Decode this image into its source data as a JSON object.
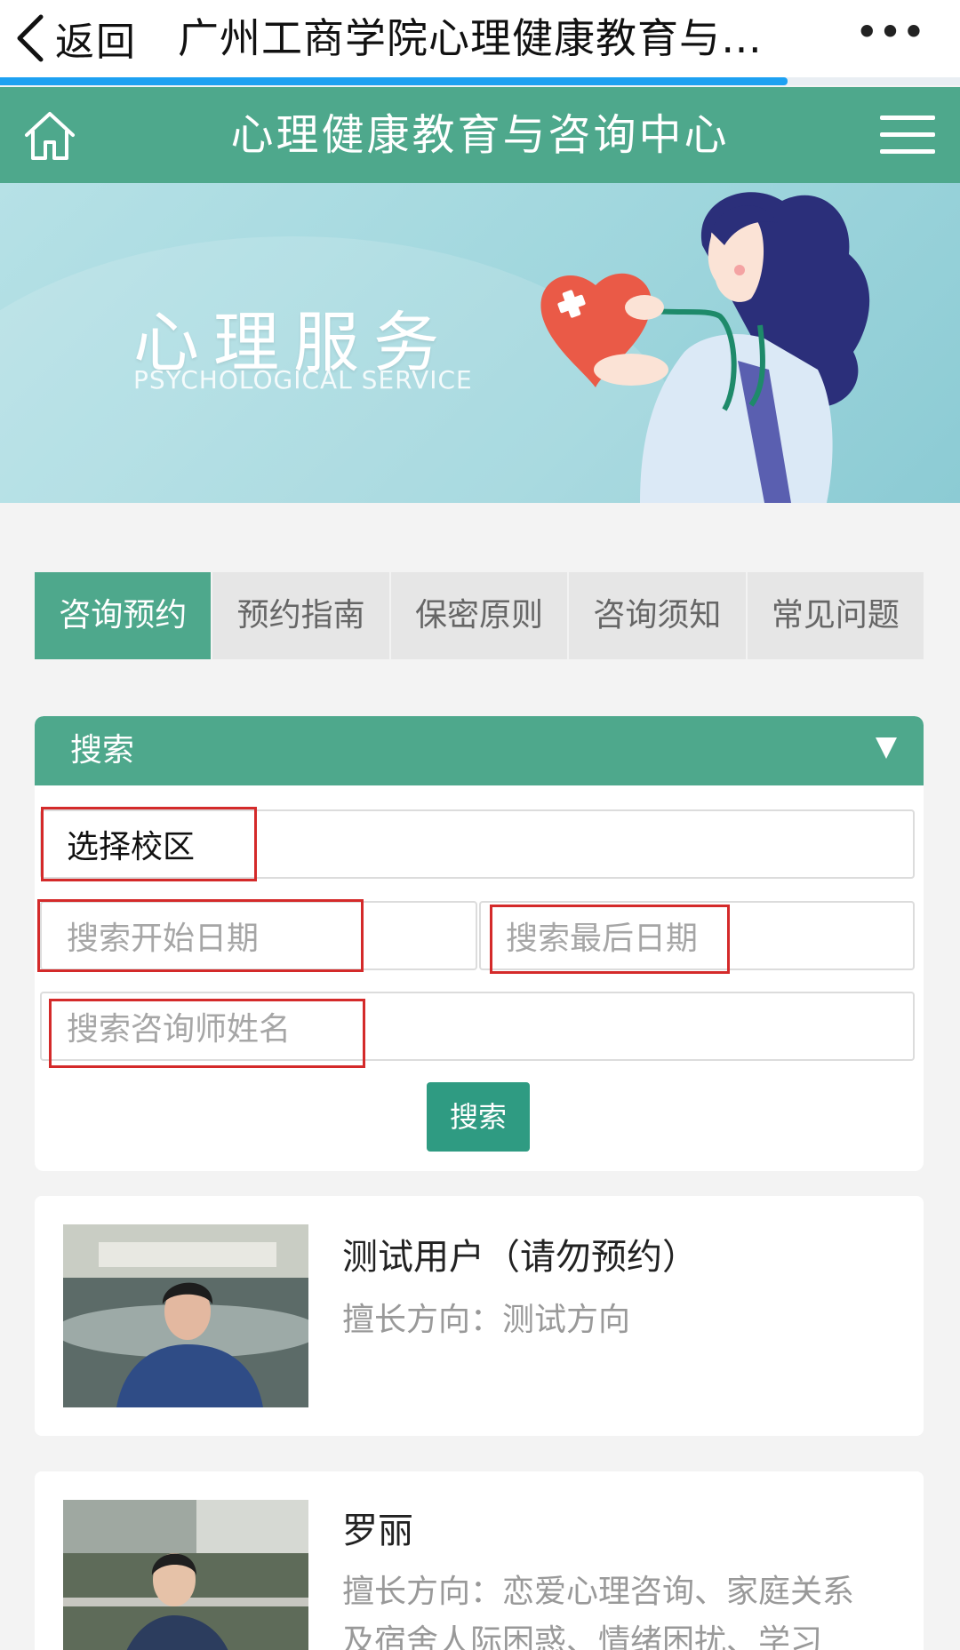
{
  "topbar": {
    "back_label": "返回",
    "title": "广州工商学院心理健康教育与…",
    "more_label": "•••",
    "load_progress": 0.82
  },
  "header": {
    "title": "心理健康教育与咨询中心"
  },
  "banner": {
    "title": "心理服务",
    "subtitle": "PSYCHOLOGICAL SERVICE"
  },
  "tabs": [
    {
      "label": "咨询预约",
      "active": true
    },
    {
      "label": "预约指南",
      "active": false
    },
    {
      "label": "保密原则",
      "active": false
    },
    {
      "label": "咨询须知",
      "active": false
    },
    {
      "label": "常见问题",
      "active": false
    }
  ],
  "search": {
    "header_label": "搜索",
    "campus_select": "选择校区",
    "start_date_placeholder": "搜索开始日期",
    "end_date_placeholder": "搜索最后日期",
    "counselor_placeholder": "搜索咨询师姓名",
    "button_label": "搜索"
  },
  "counselors": [
    {
      "name": "测试用户（请勿预约）",
      "specialty": "擅长方向：测试方向"
    },
    {
      "name": "罗丽",
      "specialty": "擅长方向：恋爱心理咨询、家庭关系及宿舍人际困惑、情绪困扰、学习"
    }
  ],
  "colors": {
    "primary_green": "#4ea88c",
    "button_green": "#2f9b82",
    "highlight_red": "#d42a2a",
    "progress_blue": "#1da1f2"
  }
}
